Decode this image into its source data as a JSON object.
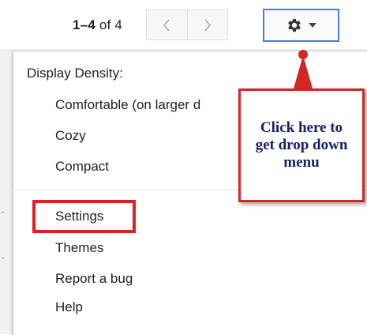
{
  "toolbar": {
    "pager_range": "1–4",
    "pager_of": " of ",
    "pager_total": "4"
  },
  "menu": {
    "heading": "Display Density:",
    "density_options": [
      {
        "label": "Comfortable (on larger d"
      },
      {
        "label": "Cozy"
      },
      {
        "label": "Compact"
      }
    ],
    "items": [
      {
        "label": "Settings",
        "highlighted": true
      },
      {
        "label": "Themes"
      },
      {
        "label": "Report a bug"
      },
      {
        "label": "Help"
      }
    ]
  },
  "callout": {
    "text": "Click here to get drop down menu"
  },
  "icons": {
    "prev": "chevron-left-icon",
    "next": "chevron-right-icon",
    "settings": "gear-icon",
    "dropdown": "caret-down-icon"
  },
  "colors": {
    "highlight_red": "#e02020",
    "callout_border": "#d42525",
    "callout_text": "#16206b",
    "gear_button_border": "#4d7ce0"
  }
}
